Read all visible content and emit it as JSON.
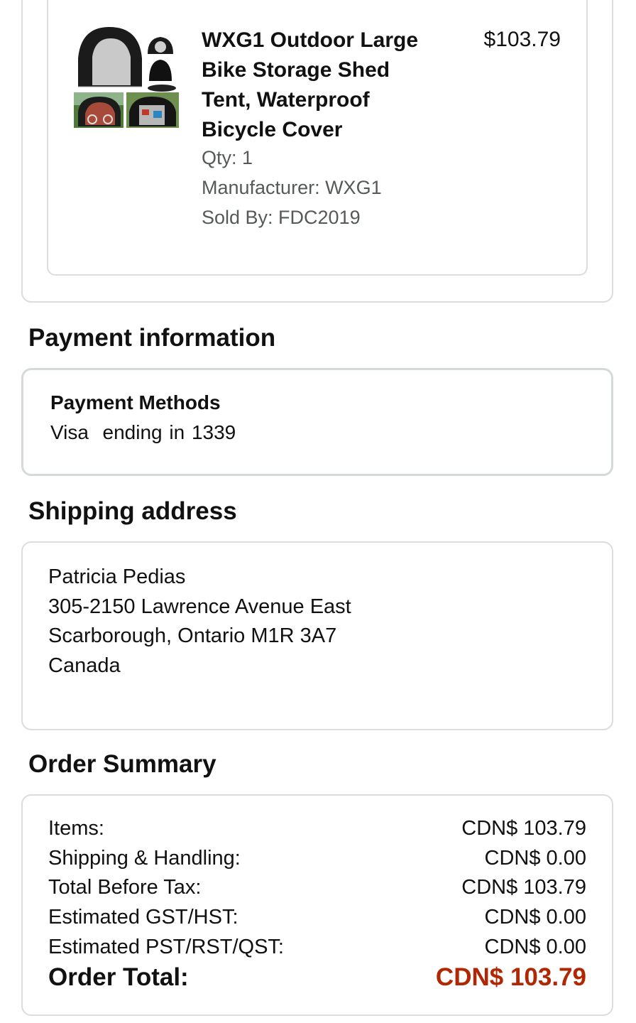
{
  "item": {
    "title_lines": [
      "WXG1 Outdoor Large",
      "Bike Storage Shed",
      "Tent, Waterproof",
      "Bicycle Cover"
    ],
    "price": "$103.79",
    "qty": "Qty: 1",
    "manufacturer": "Manufacturer: WXG1",
    "sold_by": "Sold By: FDC2019",
    "image": "bike-storage-tent-thumbnail"
  },
  "payment": {
    "heading": "Payment information",
    "methods_label": "Payment Methods",
    "method_value": "Visa  ending in 1339"
  },
  "shipping": {
    "heading": "Shipping address",
    "name": "Patricia Pedias",
    "street": "305-2150 Lawrence Avenue East",
    "city": "Scarborough, Ontario M1R 3A7",
    "country": "Canada"
  },
  "summary": {
    "heading": "Order Summary",
    "rows": [
      {
        "label": "Items:",
        "value": "CDN$ 103.79"
      },
      {
        "label": "Shipping & Handling:",
        "value": "CDN$ 0.00"
      },
      {
        "label": "Total Before Tax:",
        "value": "CDN$ 103.79"
      },
      {
        "label": "Estimated GST/HST:",
        "value": "CDN$ 0.00"
      },
      {
        "label": "Estimated PST/RST/QST:",
        "value": "CDN$ 0.00"
      }
    ],
    "total_label": "Order Total:",
    "total_value": "CDN$ 103.79"
  },
  "colors": {
    "total_accent": "#b12704",
    "border": "#dcdcdc",
    "meta_text": "#565959"
  }
}
